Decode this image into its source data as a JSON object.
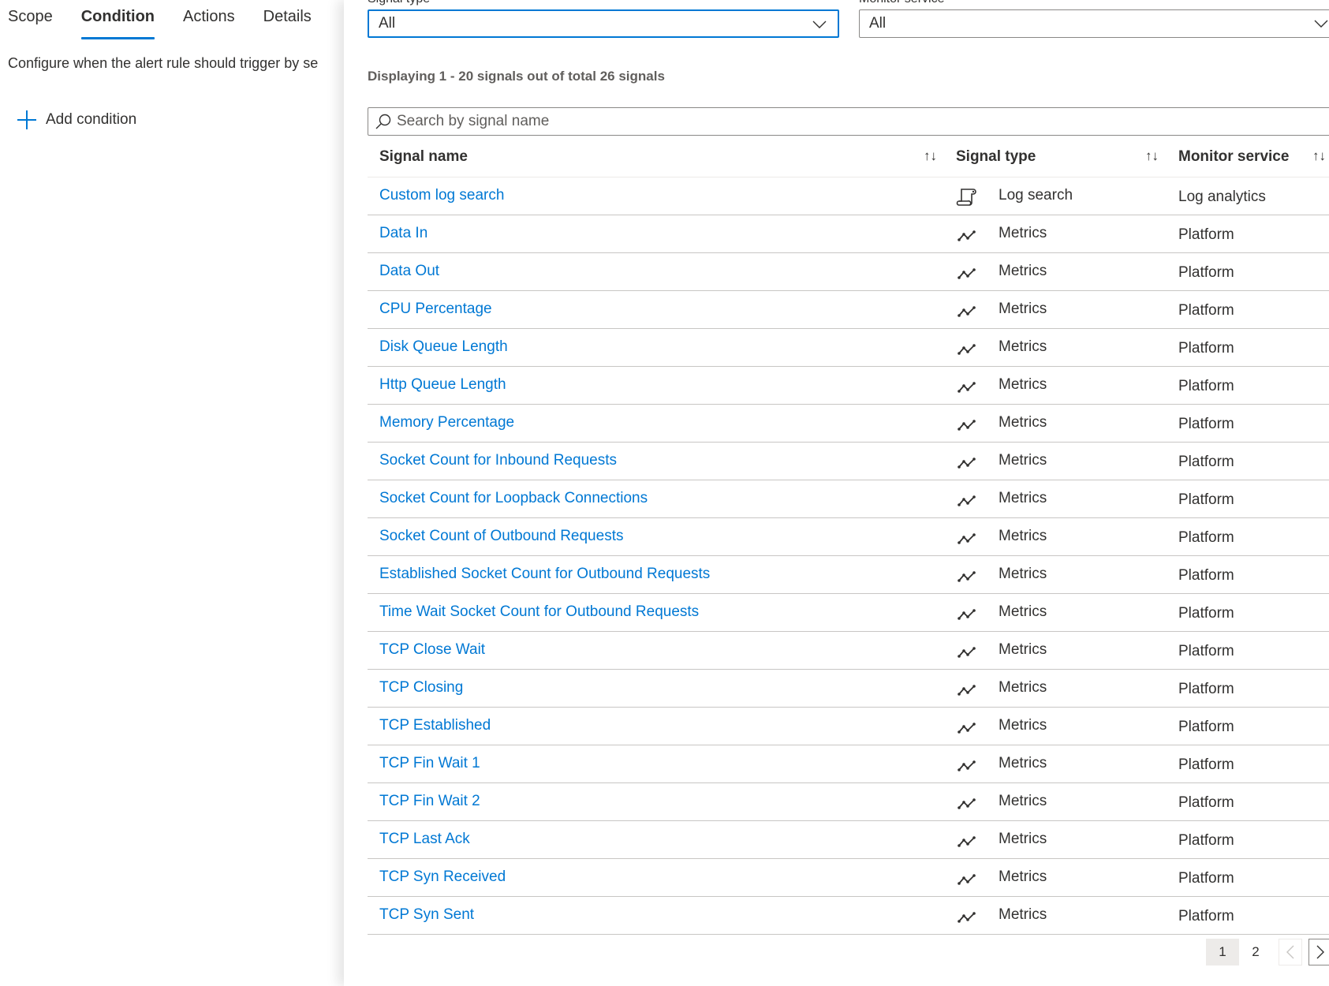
{
  "tabs": [
    {
      "label": "Scope",
      "active": false
    },
    {
      "label": "Condition",
      "active": true
    },
    {
      "label": "Actions",
      "active": false
    },
    {
      "label": "Details",
      "active": false
    }
  ],
  "left": {
    "description": "Configure when the alert rule should trigger by se",
    "add_condition_label": "Add condition",
    "accent_color": "#0078d4"
  },
  "filters": {
    "signal_type": {
      "label": "Signal type",
      "value": "All"
    },
    "monitor_service": {
      "label": "Monitor service",
      "value": "All"
    }
  },
  "display_count": "Displaying 1 - 20 signals out of total 26 signals",
  "search": {
    "placeholder": "Search by signal name",
    "value": ""
  },
  "table": {
    "columns": [
      {
        "label": "Signal name",
        "sort_icon": "↑↓"
      },
      {
        "label": "Signal type",
        "sort_icon": "↑↓"
      },
      {
        "label": "Monitor service",
        "sort_icon": "↑↓"
      }
    ],
    "rows": [
      {
        "name": "Custom log search",
        "type": "Log search",
        "type_icon": "log-search-icon",
        "service": "Log analytics"
      },
      {
        "name": "Data In",
        "type": "Metrics",
        "type_icon": "metrics-icon",
        "service": "Platform"
      },
      {
        "name": "Data Out",
        "type": "Metrics",
        "type_icon": "metrics-icon",
        "service": "Platform"
      },
      {
        "name": "CPU Percentage",
        "type": "Metrics",
        "type_icon": "metrics-icon",
        "service": "Platform"
      },
      {
        "name": "Disk Queue Length",
        "type": "Metrics",
        "type_icon": "metrics-icon",
        "service": "Platform"
      },
      {
        "name": "Http Queue Length",
        "type": "Metrics",
        "type_icon": "metrics-icon",
        "service": "Platform"
      },
      {
        "name": "Memory Percentage",
        "type": "Metrics",
        "type_icon": "metrics-icon",
        "service": "Platform"
      },
      {
        "name": "Socket Count for Inbound Requests",
        "type": "Metrics",
        "type_icon": "metrics-icon",
        "service": "Platform"
      },
      {
        "name": "Socket Count for Loopback Connections",
        "type": "Metrics",
        "type_icon": "metrics-icon",
        "service": "Platform"
      },
      {
        "name": "Socket Count of Outbound Requests",
        "type": "Metrics",
        "type_icon": "metrics-icon",
        "service": "Platform"
      },
      {
        "name": "Established Socket Count for Outbound Requests",
        "type": "Metrics",
        "type_icon": "metrics-icon",
        "service": "Platform"
      },
      {
        "name": "Time Wait Socket Count for Outbound Requests",
        "type": "Metrics",
        "type_icon": "metrics-icon",
        "service": "Platform"
      },
      {
        "name": "TCP Close Wait",
        "type": "Metrics",
        "type_icon": "metrics-icon",
        "service": "Platform"
      },
      {
        "name": "TCP Closing",
        "type": "Metrics",
        "type_icon": "metrics-icon",
        "service": "Platform"
      },
      {
        "name": "TCP Established",
        "type": "Metrics",
        "type_icon": "metrics-icon",
        "service": "Platform"
      },
      {
        "name": "TCP Fin Wait 1",
        "type": "Metrics",
        "type_icon": "metrics-icon",
        "service": "Platform"
      },
      {
        "name": "TCP Fin Wait 2",
        "type": "Metrics",
        "type_icon": "metrics-icon",
        "service": "Platform"
      },
      {
        "name": "TCP Last Ack",
        "type": "Metrics",
        "type_icon": "metrics-icon",
        "service": "Platform"
      },
      {
        "name": "TCP Syn Received",
        "type": "Metrics",
        "type_icon": "metrics-icon",
        "service": "Platform"
      },
      {
        "name": "TCP Syn Sent",
        "type": "Metrics",
        "type_icon": "metrics-icon",
        "service": "Platform"
      }
    ]
  },
  "pagination": {
    "pages": [
      "1",
      "2"
    ],
    "current_page": "1",
    "prev_enabled": false,
    "next_enabled": true
  }
}
